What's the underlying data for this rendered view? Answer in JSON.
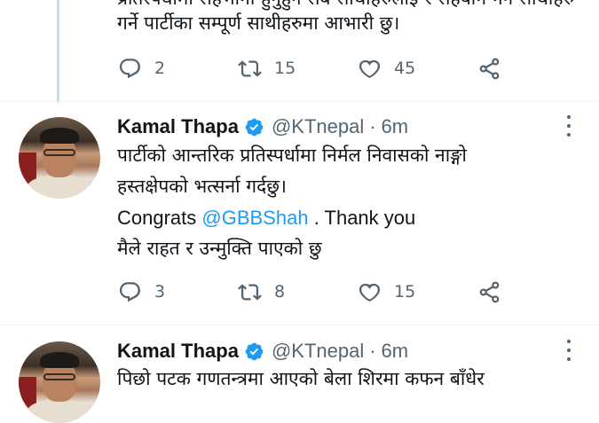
{
  "colors": {
    "accent": "#1d9bf0",
    "muted": "#536471",
    "text": "#0f1419",
    "thread_line": "#cfd9de"
  },
  "tweet0": {
    "text_line1": "प्रतिस्पर्धामा सहभागी हुनुहुने सबै साथीहरुलाई र सहयोग गर्ने साथीहरु",
    "text_line2": "गर्ने पार्टीका सम्पूर्ण साथीहरुमा आभारी छु।",
    "replies": "2",
    "retweets": "15",
    "likes": "45"
  },
  "tweet1": {
    "name": "Kamal Thapa",
    "handle": "@KTnepal",
    "dot": "·",
    "time": "6m",
    "line1": "पार्टीको आन्तरिक प्रतिस्पर्धामा निर्मल निवासको नाङ्गो",
    "line2": "हस्तक्षेपको भत्सर्ना गर्दछु।",
    "line3_pre": "Congrats ",
    "line3_mention": "@GBBShah",
    "line3_post": " . Thank you",
    "line4": "मैले राहत र उन्मुक्ति पाएको छु",
    "replies": "3",
    "retweets": "8",
    "likes": "15"
  },
  "tweet2": {
    "name": "Kamal Thapa",
    "handle": "@KTnepal",
    "dot": "·",
    "time": "6m",
    "line1": "पिछो पटक गणतन्त्रमा आएको बेला शिरमा कफन बाँधेर"
  },
  "icons": [
    "reply-icon",
    "retweet-icon",
    "like-icon",
    "share-icon",
    "verified-icon",
    "more-icon"
  ]
}
